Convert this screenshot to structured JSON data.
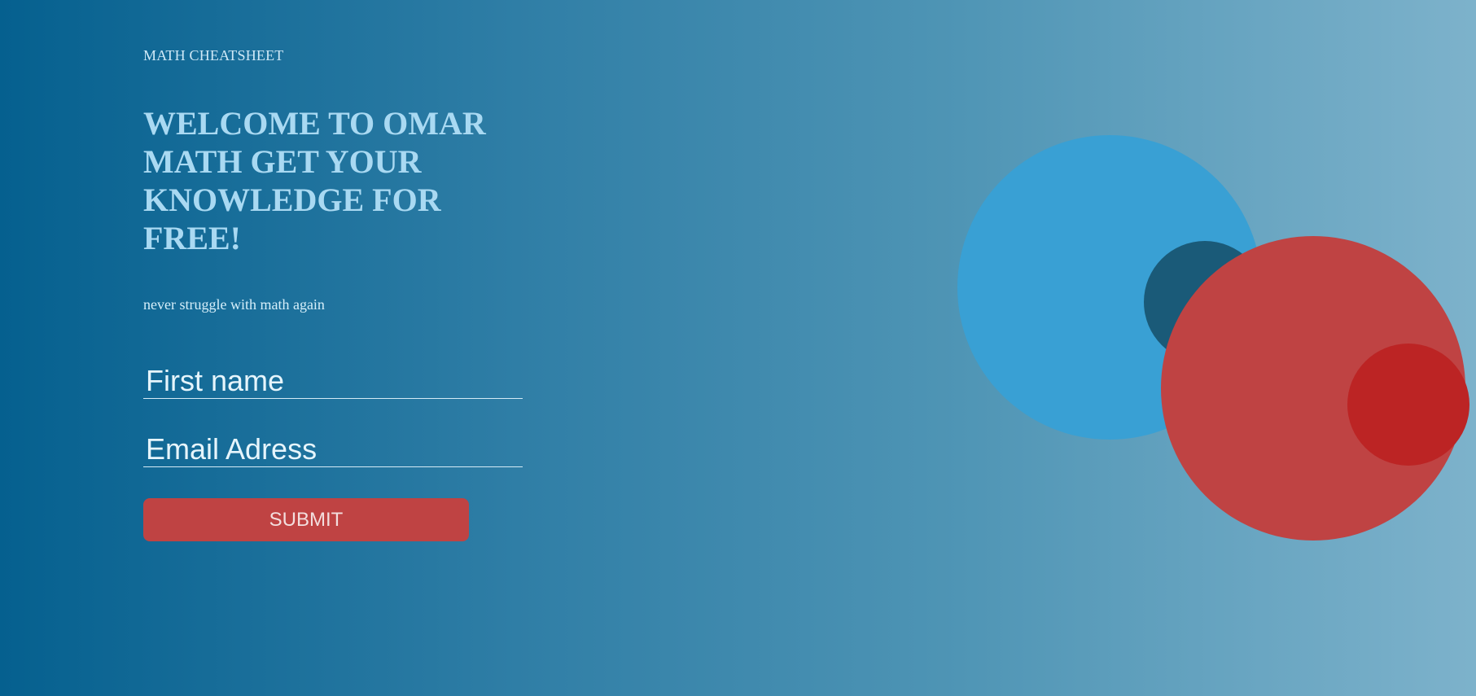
{
  "header": {
    "brand": "MATH CHEATSHEET"
  },
  "hero": {
    "title": "WELCOME TO OMAR MATH GET YOUR KNOWLEDGE FOR FREE!",
    "subtitle": "never struggle with math again"
  },
  "form": {
    "first_name_placeholder": "First name",
    "first_name_value": "",
    "email_placeholder": "Email Adress",
    "email_value": "",
    "submit_label": "SUBMIT"
  },
  "colors": {
    "background_start": "#05608f",
    "background_end": "#7db2cb",
    "accent": "#bf4343",
    "blue_circle": "#39a0d4",
    "dark_circle": "#1a5a78",
    "red_circle": "#bc2424"
  }
}
